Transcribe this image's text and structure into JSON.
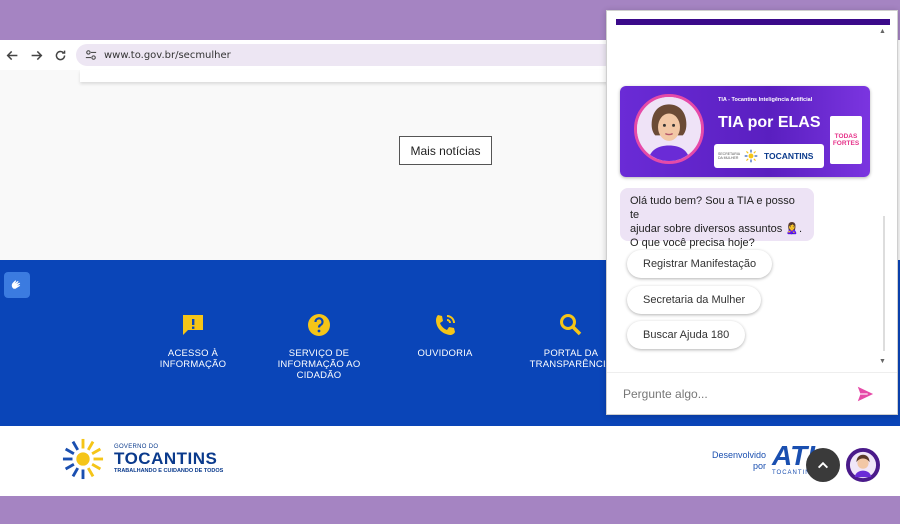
{
  "browser": {
    "url": "www.to.gov.br/secmulher"
  },
  "page": {
    "more_news_label": "Mais notícias",
    "footer_items": [
      {
        "icon": "alert-icon",
        "label": "ACESSO À INFORMAÇÃO"
      },
      {
        "icon": "question-icon",
        "label": "SERVIÇO DE INFORMAÇÃO AO CIDADÃO"
      },
      {
        "icon": "phone-icon",
        "label": "OUVIDORIA"
      },
      {
        "icon": "search-icon",
        "label": "PORTAL DA TRANSPARÊNCIA"
      }
    ],
    "gov": {
      "small": "GOVERNO DO",
      "name": "TOCANTINS",
      "slogan": "TRABALHANDO E CUIDANDO DE TODOS"
    },
    "developed_by": "Desenvolvido por",
    "ati": {
      "name": "ATI",
      "sub": "TOCANTINS"
    }
  },
  "chat": {
    "banner": {
      "kicker": "TIA - Tocantins Inteligência Artificial",
      "title": "TIA por ELAS",
      "logo_small": "SECRETARIA DA MULHER",
      "logo_name": "TOCANTINS",
      "badge": "TODAS FORTES"
    },
    "greeting_line1": "Olá tudo bem? Sou a TIA e posso te",
    "greeting_line2": "ajudar sobre diversos assuntos 🙎‍♀️.",
    "greeting_line3": "O que você precisa hoje?",
    "options": [
      "Registrar Manifestação",
      "Secretaria da Mulher",
      "Buscar Ajuda 180"
    ],
    "input_placeholder": "Pergunte algo..."
  },
  "colors": {
    "outer_bg": "#a584c2",
    "footer_blue": "#0a45b8",
    "icon_yellow": "#f5c518",
    "chat_header": "#3b0a8a",
    "bubble_bg": "#ede3f5",
    "send_pink": "#e64aa8"
  }
}
